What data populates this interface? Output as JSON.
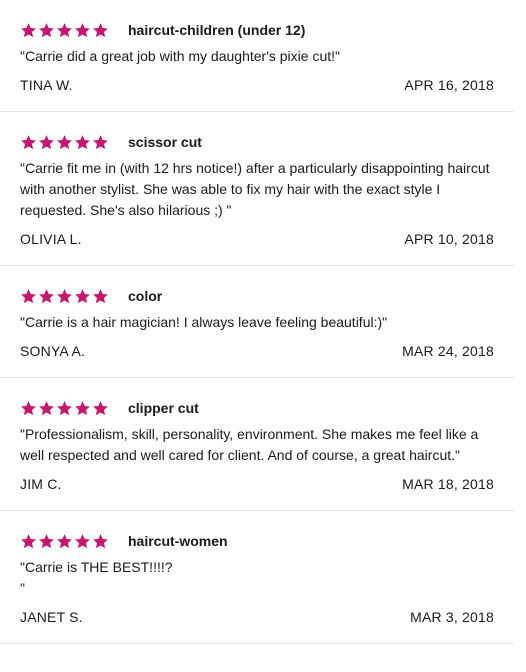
{
  "theme": {
    "star_color": "#c8156e",
    "divider_color": "#e4e4e4"
  },
  "icons": {
    "rating_star": "star-icon"
  },
  "reviews": [
    {
      "rating": 5,
      "service": "haircut-children (under 12)",
      "text": "\"Carrie did a great job with my daughter's pixie cut!\"",
      "author": "TINA W.",
      "date": "APR 16, 2018"
    },
    {
      "rating": 5,
      "service": "scissor cut",
      "text": "\"Carrie fit me in (with 12 hrs notice!) after a particularly disappointing haircut with another stylist. She was able to fix my hair with the exact style I requested. She's also hilarious ;) \"",
      "author": "OLIVIA L.",
      "date": "APR 10, 2018"
    },
    {
      "rating": 5,
      "service": "color",
      "text": "\"Carrie is a hair magician!  I always leave feeling beautiful:)\"",
      "author": "SONYA A.",
      "date": "MAR 24, 2018"
    },
    {
      "rating": 5,
      "service": "clipper cut",
      "text": "\"Professionalism, skill, personality, environment.  She makes me feel like a well respected and well cared for client.  And of course, a great haircut.\"",
      "author": "JIM C.",
      "date": "MAR 18, 2018"
    },
    {
      "rating": 5,
      "service": "haircut-women",
      "text": "\"Carrie is THE BEST!!!!?\n\"",
      "author": "JANET S.",
      "date": "MAR 3, 2018"
    }
  ]
}
